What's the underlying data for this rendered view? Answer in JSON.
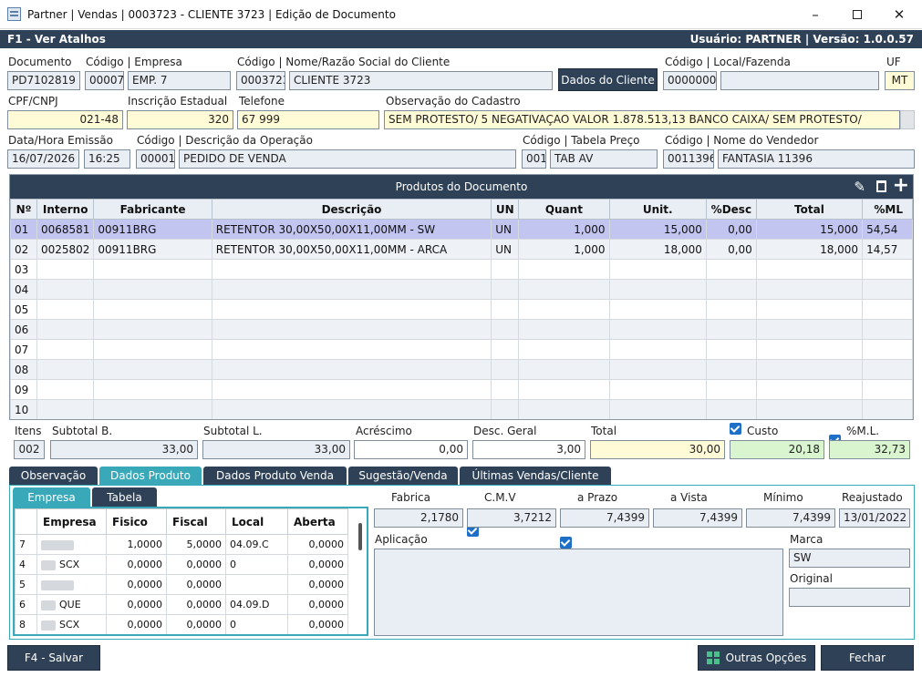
{
  "window": {
    "title": "Partner | Vendas | 0003723 - CLIENTE 3723 | Edição de Documento"
  },
  "bar": {
    "left": "F1 - Ver Atalhos",
    "right": "Usuário: PARTNER | Versão: 1.0.0.57"
  },
  "header": {
    "documento_label": "Documento",
    "documento": "PD7102819",
    "empresa_label": "Código | Empresa",
    "empresa_cod": "00007",
    "empresa_nome": "EMP. 7",
    "cliente_label": "Código | Nome/Razão Social do Cliente",
    "cliente_cod": "0003723",
    "cliente_nome": "CLIENTE 3723",
    "dados_cliente_btn": "Dados do Cliente",
    "local_label": "Código | Local/Fazenda",
    "local_cod": "0000000",
    "local_nome": "",
    "uf_label": "UF",
    "uf": "MT",
    "cpf_label": "CPF/CNPJ",
    "cpf": "021-48",
    "ie_label": "Inscrição Estadual",
    "ie": "320",
    "tel_label": "Telefone",
    "tel": "67 999",
    "obs_label": "Observação do Cadastro",
    "obs": "SEM PROTESTO/ 5 NEGATIVAÇAO VALOR 1.878.513,13 BANCO CAIXA/  SEM PROTESTO/",
    "emissao_label": "Data/Hora Emissão",
    "data": "16/07/2026",
    "hora": "16:25",
    "operacao_label": "Código | Descrição da Operação",
    "op_cod": "00001",
    "op_desc": "PEDIDO DE VENDA",
    "tabela_label": "Código | Tabela Preço",
    "tab_cod": "001",
    "tab_desc": "TAB AV",
    "vendedor_label": "Código | Nome do Vendedor",
    "vend_cod": "0011396",
    "vend_nome": "FANTASIA 11396"
  },
  "products": {
    "title": "Produtos do Documento",
    "columns": [
      "Nº",
      "Interno",
      "Fabricante",
      "Descrição",
      "UN",
      "Quant",
      "Unit.",
      "%Desc",
      "Total",
      "%ML"
    ],
    "rows": [
      [
        "01",
        "0068581",
        "00911BRG",
        "RETENTOR 30,00X50,00X11,00MM - SW",
        "UN",
        "1,000",
        "15,000",
        "0,00",
        "15,000",
        "54,54"
      ],
      [
        "02",
        "0025802",
        "00911BRG",
        "RETENTOR 30,00X50,00X11,00MM - ARCA",
        "UN",
        "1,000",
        "18,000",
        "0,00",
        "18,000",
        "14,57"
      ],
      [
        "03",
        "",
        "",
        "",
        "",
        "",
        "",
        "",
        "",
        ""
      ],
      [
        "04",
        "",
        "",
        "",
        "",
        "",
        "",
        "",
        "",
        ""
      ],
      [
        "05",
        "",
        "",
        "",
        "",
        "",
        "",
        "",
        "",
        ""
      ],
      [
        "06",
        "",
        "",
        "",
        "",
        "",
        "",
        "",
        "",
        ""
      ],
      [
        "07",
        "",
        "",
        "",
        "",
        "",
        "",
        "",
        "",
        ""
      ],
      [
        "08",
        "",
        "",
        "",
        "",
        "",
        "",
        "",
        "",
        ""
      ],
      [
        "09",
        "",
        "",
        "",
        "",
        "",
        "",
        "",
        "",
        ""
      ],
      [
        "10",
        "",
        "",
        "",
        "",
        "",
        "",
        "",
        "",
        ""
      ]
    ]
  },
  "totals": {
    "itens_label": "Itens",
    "itens": "002",
    "subtotal_b_label": "Subtotal B.",
    "subtotal_b": "33,00",
    "subtotal_l_label": "Subtotal L.",
    "subtotal_l": "33,00",
    "acrescimo_label": "Acréscimo",
    "acrescimo": "0,00",
    "desc_label": "Desc. Geral",
    "desc": "3,00",
    "total_label": "Total",
    "total": "30,00",
    "custo_label": "Custo",
    "custo": "20,18",
    "ml_label": "%M.L.",
    "ml": "32,73"
  },
  "tabs": [
    "Observação",
    "Dados Produto",
    "Dados Produto Venda",
    "Sugestão/Venda",
    "Últimas Vendas/Cliente"
  ],
  "subtabs": [
    "Empresa",
    "Tabela"
  ],
  "empresa": {
    "columns": [
      "",
      "Empresa",
      "Fisico",
      "Fiscal",
      "Local",
      "Aberta"
    ],
    "rows": [
      [
        "7",
        "",
        "1,0000",
        "5,0000",
        "04.09.C",
        "0,0000"
      ],
      [
        "4",
        "SCX",
        "0,0000",
        "0,0000",
        "0",
        "0,0000"
      ],
      [
        "5",
        "",
        "0,0000",
        "0,0000",
        "",
        "0,0000"
      ],
      [
        "6",
        "QUE",
        "0,0000",
        "0,0000",
        "04.09.D",
        "0,0000"
      ],
      [
        "8",
        "SCX",
        "0,0000",
        "0,0000",
        "0",
        "0,0000"
      ]
    ]
  },
  "dados": {
    "fabrica_label": "Fabrica",
    "fabrica": "2,1780",
    "cmv_label": "C.M.V",
    "cmv": "3,7212",
    "prazo_label": "a Prazo",
    "prazo": "7,4399",
    "vista_label": "a Vista",
    "vista": "7,4399",
    "minimo_label": "Mínimo",
    "minimo": "7,4399",
    "reaj_label": "Reajustado",
    "reaj": "13/01/2022",
    "aplicacao_label": "Aplicação",
    "aplicacao": "",
    "marca_label": "Marca",
    "marca": "SW",
    "original_label": "Original",
    "original": ""
  },
  "footer": {
    "salvar": "F4 - Salvar",
    "outras": "Outras Opções",
    "fechar": "Fechar"
  }
}
